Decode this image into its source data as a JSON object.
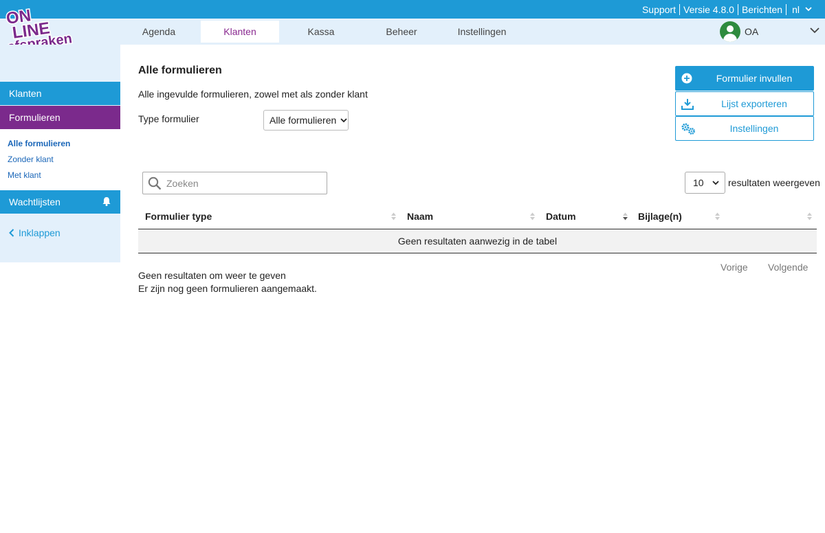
{
  "logo": {
    "text": "ONLINE afspraken .NL"
  },
  "topbar": {
    "links": [
      "Support",
      "Versie 4.8.0",
      "Berichten"
    ],
    "language": "nl"
  },
  "nav": {
    "items": [
      "Agenda",
      "Klanten",
      "Kassa",
      "Beheer",
      "Instellingen"
    ],
    "active": "Klanten",
    "user_initials": "OA"
  },
  "sidebar": {
    "klanten": "Klanten",
    "formulieren": "Formulieren",
    "sub_items": [
      "Alle formulieren",
      "Zonder klant",
      "Met klant"
    ],
    "wachtlijsten": "Wachtlijsten",
    "collapse": "Inklappen"
  },
  "main": {
    "title": "Alle formulieren",
    "description": "Alle ingevulde formulieren, zowel met als zonder klant",
    "type_label": "Type formulier",
    "type_value": "Alle formulieren"
  },
  "actions": {
    "fill_form": "Formulier invullen",
    "export": "Lijst exporteren",
    "settings": "Instellingen"
  },
  "table": {
    "search_placeholder": "Zoeken",
    "page_length": "10",
    "page_length_label": "resultaten weergeven",
    "columns": [
      "Formulier type",
      "Naam",
      "Datum",
      "Bijlage(n)"
    ],
    "empty": "Geen resultaten aanwezig in de tabel",
    "info": "Geen resultaten om weer te geven",
    "previous": "Vorige",
    "next": "Volgende"
  },
  "note": "Er zijn nog geen formulieren aangemaakt.",
  "colors": {
    "primary_blue": "#1e9ad6",
    "purple": "#7b2a8c",
    "light_blue": "#e3f0fb",
    "logo_purple": "#7b2a8c"
  }
}
